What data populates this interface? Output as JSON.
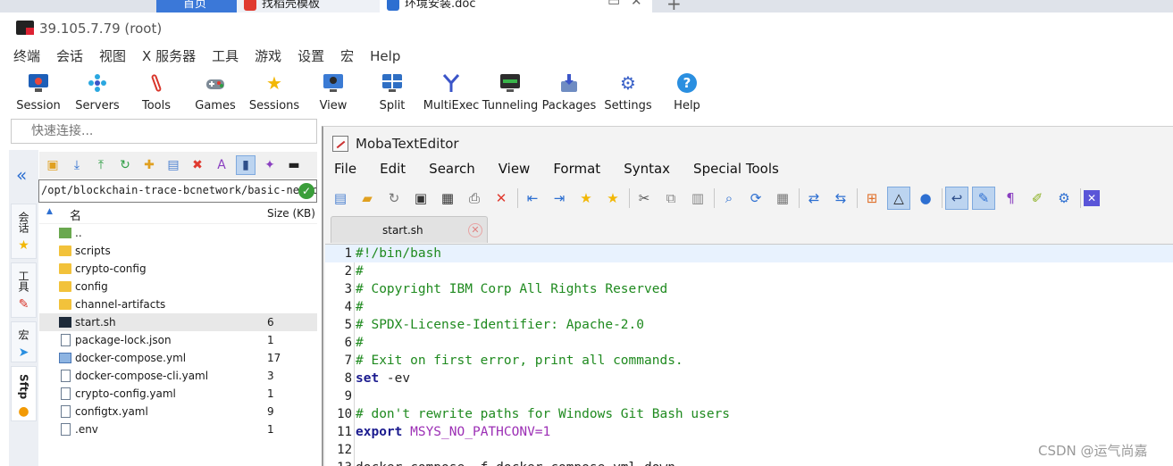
{
  "browser_tabs": [
    {
      "label": "首页",
      "color": "#3b78d8"
    },
    {
      "label": "找稻壳模板",
      "color": "#e03a2f"
    },
    {
      "label": "环境安装.doc",
      "color": "#2d6fd1"
    }
  ],
  "window": {
    "title": "39.105.7.79 (root)"
  },
  "menu": [
    "终端",
    "会话",
    "视图",
    "X 服务器",
    "工具",
    "游戏",
    "设置",
    "宏",
    "Help"
  ],
  "toolbar": [
    {
      "label": "Session",
      "icon": "session-icon"
    },
    {
      "label": "Servers",
      "icon": "servers-icon"
    },
    {
      "label": "Tools",
      "icon": "tools-icon"
    },
    {
      "label": "Games",
      "icon": "games-icon"
    },
    {
      "label": "Sessions",
      "icon": "star-icon"
    },
    {
      "label": "View",
      "icon": "view-icon"
    },
    {
      "label": "Split",
      "icon": "split-icon"
    },
    {
      "label": "MultiExec",
      "icon": "multiexec-icon"
    },
    {
      "label": "Tunneling",
      "icon": "tunneling-icon"
    },
    {
      "label": "Packages",
      "icon": "packages-icon"
    },
    {
      "label": "Settings",
      "icon": "gear-icon"
    },
    {
      "label": "Help",
      "icon": "help-icon"
    }
  ],
  "quick_connect": {
    "placeholder": "快速连接..."
  },
  "side_tabs": [
    "会话",
    "工具",
    "宏",
    "Sftp"
  ],
  "sftp": {
    "path": "/opt/blockchain-trace-bcnetwork/basic-network",
    "columns": {
      "name": "名",
      "size": "Size (KB)"
    },
    "files": [
      {
        "name": "..",
        "size": "",
        "type": "up"
      },
      {
        "name": "scripts",
        "size": "",
        "type": "folder"
      },
      {
        "name": "crypto-config",
        "size": "",
        "type": "folder"
      },
      {
        "name": "config",
        "size": "",
        "type": "folder"
      },
      {
        "name": "channel-artifacts",
        "size": "",
        "type": "folder"
      },
      {
        "name": "start.sh",
        "size": "6",
        "type": "sh"
      },
      {
        "name": "package-lock.json",
        "size": "1",
        "type": "doc"
      },
      {
        "name": "docker-compose.yml",
        "size": "17",
        "type": "yml"
      },
      {
        "name": "docker-compose-cli.yaml",
        "size": "3",
        "type": "doc"
      },
      {
        "name": "crypto-config.yaml",
        "size": "1",
        "type": "doc"
      },
      {
        "name": "configtx.yaml",
        "size": "9",
        "type": "doc"
      },
      {
        "name": ".env",
        "size": "1",
        "type": "doc"
      }
    ],
    "selected_index": 5
  },
  "editor": {
    "title": "MobaTextEditor",
    "menu": [
      "File",
      "Edit",
      "Search",
      "View",
      "Format",
      "Syntax",
      "Special Tools"
    ],
    "tab": "start.sh",
    "lines": [
      {
        "n": "1",
        "segments": [
          {
            "t": "#!/bin/bash",
            "c": "cm"
          }
        ]
      },
      {
        "n": "2",
        "segments": [
          {
            "t": "#",
            "c": "cm"
          }
        ]
      },
      {
        "n": "3",
        "segments": [
          {
            "t": "# Copyright IBM Corp All Rights Reserved",
            "c": "cm"
          }
        ]
      },
      {
        "n": "4",
        "segments": [
          {
            "t": "#",
            "c": "cm"
          }
        ]
      },
      {
        "n": "5",
        "segments": [
          {
            "t": "# SPDX-License-Identifier: Apache-2.0",
            "c": "cm"
          }
        ]
      },
      {
        "n": "6",
        "segments": [
          {
            "t": "#",
            "c": "cm"
          }
        ]
      },
      {
        "n": "7",
        "segments": [
          {
            "t": "# Exit on first error, print all commands.",
            "c": "cm"
          }
        ]
      },
      {
        "n": "8",
        "segments": [
          {
            "t": "set",
            "c": "kw"
          },
          {
            "t": " -ev",
            "c": "pl"
          }
        ]
      },
      {
        "n": "9",
        "segments": []
      },
      {
        "n": "10",
        "segments": [
          {
            "t": "# don't rewrite paths for Windows Git Bash users",
            "c": "cm"
          }
        ]
      },
      {
        "n": "11",
        "segments": [
          {
            "t": "export",
            "c": "kw"
          },
          {
            "t": " MSYS_NO_PATHCONV=1",
            "c": "vr"
          }
        ]
      },
      {
        "n": "12",
        "segments": []
      },
      {
        "n": "13",
        "segments": [
          {
            "t": "docker-compose -f docker-compose.yml down",
            "c": "pl"
          }
        ]
      }
    ]
  },
  "watermark": "CSDN @运气尚嘉"
}
